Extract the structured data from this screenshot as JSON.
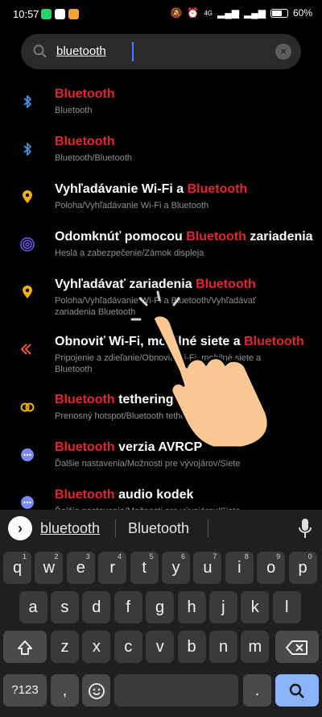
{
  "status_bar": {
    "time": "10:57",
    "battery": "60%",
    "network": "4G",
    "apps": [
      {
        "name": "whatsapp-icon",
        "color": "#25D366"
      },
      {
        "name": "gmail-icon",
        "color": "#FFFFFF"
      },
      {
        "name": "app-icon",
        "color": "#F4A236"
      }
    ]
  },
  "search": {
    "query": "bluetooth",
    "clear_glyph": "×"
  },
  "results": [
    {
      "icon": "bluetooth-icon",
      "icon_color": "#4a90e2",
      "before": "",
      "highlight": "Bluetooth",
      "after": "",
      "subtitle": "Bluetooth"
    },
    {
      "icon": "bluetooth-icon",
      "icon_color": "#4a90e2",
      "before": "",
      "highlight": "Bluetooth",
      "after": "",
      "subtitle": "Bluetooth/Bluetooth"
    },
    {
      "icon": "location-icon",
      "icon_color": "#f4b21a",
      "before": "Vyhľadávanie Wi-Fi a ",
      "highlight": "Bluetooth",
      "after": "",
      "subtitle": "Poloha/Vyhľadávanie Wi-Fi a Bluetooth"
    },
    {
      "icon": "fingerprint-icon",
      "icon_color": "#6a5cf0",
      "before": "Odomknúť pomocou ",
      "highlight": "Bluetooth",
      "after": " zariadenia",
      "subtitle": "Heslá a zabezpečenie/Zámok displeja"
    },
    {
      "icon": "location-icon",
      "icon_color": "#f4b21a",
      "before": "Vyhľadávať zariadenia ",
      "highlight": "Bluetooth",
      "after": "",
      "subtitle": "Poloha/Vyhľadávanie Wi-Fi a Bluetooth/Vyhľadávať zariadenia Bluetooth"
    },
    {
      "icon": "reset-icon",
      "icon_color": "#e8573c",
      "before": "Obnoviť Wi-Fi, mobilné siete a ",
      "highlight": "Bluetooth",
      "after": "",
      "subtitle": "Pripojenie a zdieľanie/Obnoviť Wi-Fi, mobilné siete a Bluetooth"
    },
    {
      "icon": "tethering-icon",
      "icon_color": "#f4b21a",
      "before": "",
      "highlight": "Bluetooth",
      "after": " tethering",
      "subtitle": "Prenosný hotspot/Bluetooth tethering"
    },
    {
      "icon": "more-icon",
      "icon_color": "#7b8cf0",
      "before": "",
      "highlight": "Bluetooth",
      "after": " verzia AVRCP",
      "subtitle": "Ďalšie nastavenia/Možnosti pre vývojárov/Siete"
    },
    {
      "icon": "more-icon",
      "icon_color": "#7b8cf0",
      "before": "",
      "highlight": "Bluetooth",
      "after": " audio kodek",
      "subtitle": "Ďalšie nastavenia/Možnosti pre vývojárov/Siete"
    }
  ],
  "keyboard": {
    "suggestions": [
      "bluetooth",
      "Bluetooth"
    ],
    "row1": [
      [
        "q",
        "1"
      ],
      [
        "w",
        "2"
      ],
      [
        "e",
        "3"
      ],
      [
        "r",
        "4"
      ],
      [
        "t",
        "5"
      ],
      [
        "y",
        "6"
      ],
      [
        "u",
        "7"
      ],
      [
        "i",
        "8"
      ],
      [
        "o",
        "9"
      ],
      [
        "p",
        "0"
      ]
    ],
    "row2": [
      "a",
      "s",
      "d",
      "f",
      "g",
      "h",
      "j",
      "k",
      "l"
    ],
    "row3": [
      "z",
      "x",
      "c",
      "v",
      "b",
      "n",
      "m"
    ],
    "symbols_key": "?123",
    "comma_key": ",",
    "period_key": "."
  }
}
